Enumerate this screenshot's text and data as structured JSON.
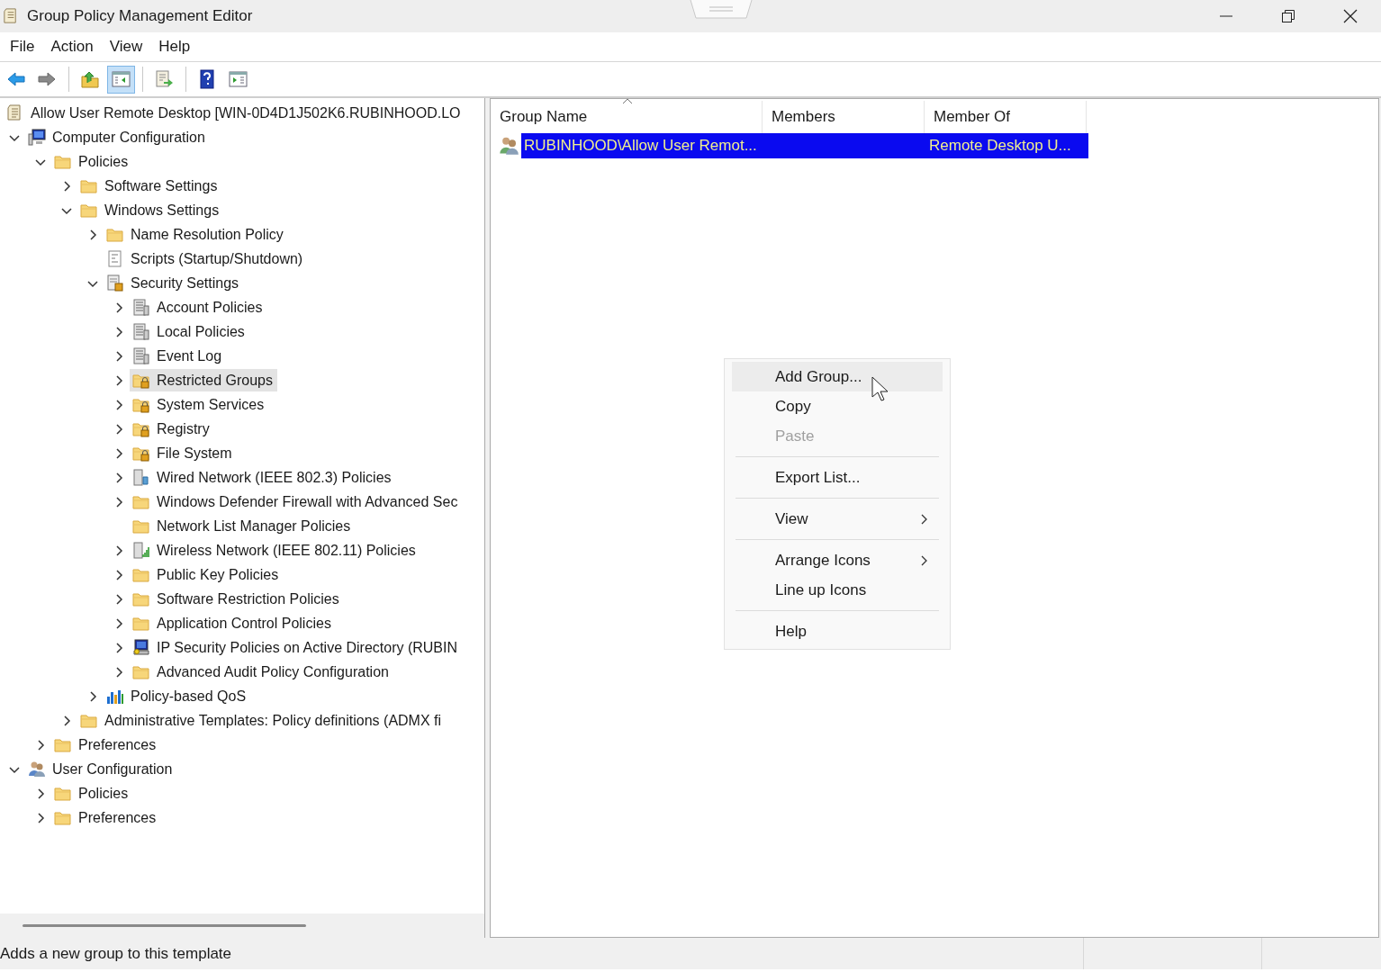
{
  "window": {
    "title": "Group Policy Management Editor"
  },
  "menu": [
    "File",
    "Action",
    "View",
    "Help"
  ],
  "toolbar": [
    [
      {
        "kind": "back",
        "pressed": false
      },
      {
        "kind": "forward",
        "pressed": false
      }
    ],
    [
      {
        "kind": "up",
        "pressed": false
      },
      {
        "kind": "tree",
        "pressed": true
      }
    ],
    [
      {
        "kind": "export",
        "pressed": false
      }
    ],
    [
      {
        "kind": "help",
        "pressed": false
      },
      {
        "kind": "pane",
        "pressed": false
      }
    ]
  ],
  "tree": [
    {
      "label": "Allow User Remote Desktop [WIN-0D4D1J502K6.RUBINHOOD.LO",
      "kind": "scroll",
      "selected": false,
      "children": [
        {
          "label": "Computer Configuration",
          "kind": "computer",
          "expanded": true,
          "selected": false,
          "children": [
            {
              "label": "Policies",
              "kind": "folder",
              "expanded": true,
              "selected": false,
              "children": [
                {
                  "label": "Software Settings",
                  "kind": "folder",
                  "expanded": false,
                  "selected": false
                },
                {
                  "label": "Windows Settings",
                  "kind": "folder",
                  "expanded": true,
                  "selected": false,
                  "children": [
                    {
                      "label": "Name Resolution Policy",
                      "kind": "folder",
                      "expanded": false,
                      "selected": false
                    },
                    {
                      "label": "Scripts (Startup/Shutdown)",
                      "kind": "script",
                      "selected": false
                    },
                    {
                      "label": "Security Settings",
                      "kind": "security",
                      "expanded": true,
                      "selected": false,
                      "children": [
                        {
                          "label": "Account Policies",
                          "kind": "policy",
                          "expanded": false,
                          "selected": false
                        },
                        {
                          "label": "Local Policies",
                          "kind": "policy",
                          "expanded": false,
                          "selected": false
                        },
                        {
                          "label": "Event Log",
                          "kind": "policy",
                          "expanded": false,
                          "selected": false
                        },
                        {
                          "label": "Restricted Groups",
                          "kind": "lockfolder",
                          "expanded": false,
                          "selected": true
                        },
                        {
                          "label": "System Services",
                          "kind": "lockfolder",
                          "expanded": false,
                          "selected": false
                        },
                        {
                          "label": "Registry",
                          "kind": "lockfolder",
                          "expanded": false,
                          "selected": false
                        },
                        {
                          "label": "File System",
                          "kind": "lockfolder",
                          "expanded": false,
                          "selected": false
                        },
                        {
                          "label": "Wired Network (IEEE 802.3) Policies",
                          "kind": "wired",
                          "expanded": false,
                          "selected": false
                        },
                        {
                          "label": "Windows Defender Firewall with Advanced Sec",
                          "kind": "folder",
                          "expanded": false,
                          "selected": false
                        },
                        {
                          "label": "Network List Manager Policies",
                          "kind": "folder",
                          "selected": false
                        },
                        {
                          "label": "Wireless Network (IEEE 802.11) Policies",
                          "kind": "wireless",
                          "expanded": false,
                          "selected": false
                        },
                        {
                          "label": "Public Key Policies",
                          "kind": "folder",
                          "expanded": false,
                          "selected": false
                        },
                        {
                          "label": "Software Restriction Policies",
                          "kind": "folder",
                          "expanded": false,
                          "selected": false
                        },
                        {
                          "label": "Application Control Policies",
                          "kind": "folder",
                          "expanded": false,
                          "selected": false
                        },
                        {
                          "label": "IP Security Policies on Active Directory (RUBIN",
                          "kind": "ipsec",
                          "expanded": false,
                          "selected": false
                        },
                        {
                          "label": "Advanced Audit Policy Configuration",
                          "kind": "folder",
                          "expanded": false,
                          "selected": false
                        }
                      ]
                    },
                    {
                      "label": "Policy-based QoS",
                      "kind": "qos",
                      "expanded": false,
                      "selected": false
                    }
                  ]
                },
                {
                  "label": "Administrative Templates: Policy definitions (ADMX fi",
                  "kind": "folder",
                  "expanded": false,
                  "selected": false
                }
              ]
            },
            {
              "label": "Preferences",
              "kind": "folder",
              "expanded": false,
              "selected": false
            }
          ]
        },
        {
          "label": "User Configuration",
          "kind": "users",
          "expanded": true,
          "selected": false,
          "children": [
            {
              "label": "Policies",
              "kind": "folder",
              "expanded": false,
              "selected": false
            },
            {
              "label": "Preferences",
              "kind": "folder",
              "expanded": false,
              "selected": false
            }
          ]
        }
      ]
    }
  ],
  "list": {
    "columns": [
      {
        "label": "Group Name",
        "sorted": true
      },
      {
        "label": "Members",
        "sorted": false
      },
      {
        "label": "Member Of",
        "sorted": false
      }
    ],
    "rows": [
      {
        "cells": [
          "RUBINHOOD\\Allow User Remot...",
          "",
          "Remote Desktop U..."
        ],
        "selected": true
      }
    ]
  },
  "context_menu": [
    {
      "kind": "item",
      "label": "Add Group...",
      "highlighted": true,
      "disabled": false,
      "submenu": false
    },
    {
      "kind": "item",
      "label": "Copy",
      "highlighted": false,
      "disabled": false,
      "submenu": false
    },
    {
      "kind": "item",
      "label": "Paste",
      "highlighted": false,
      "disabled": true,
      "submenu": false
    },
    {
      "kind": "separator"
    },
    {
      "kind": "item",
      "label": "Export List...",
      "highlighted": false,
      "disabled": false,
      "submenu": false
    },
    {
      "kind": "separator"
    },
    {
      "kind": "item",
      "label": "View",
      "highlighted": false,
      "disabled": false,
      "submenu": true
    },
    {
      "kind": "separator"
    },
    {
      "kind": "item",
      "label": "Arrange Icons",
      "highlighted": false,
      "disabled": false,
      "submenu": true
    },
    {
      "kind": "item",
      "label": "Line up Icons",
      "highlighted": false,
      "disabled": false,
      "submenu": false
    },
    {
      "kind": "separator"
    },
    {
      "kind": "item",
      "label": "Help",
      "highlighted": false,
      "disabled": false,
      "submenu": false
    }
  ],
  "status_bar": "Adds a new group to this template"
}
